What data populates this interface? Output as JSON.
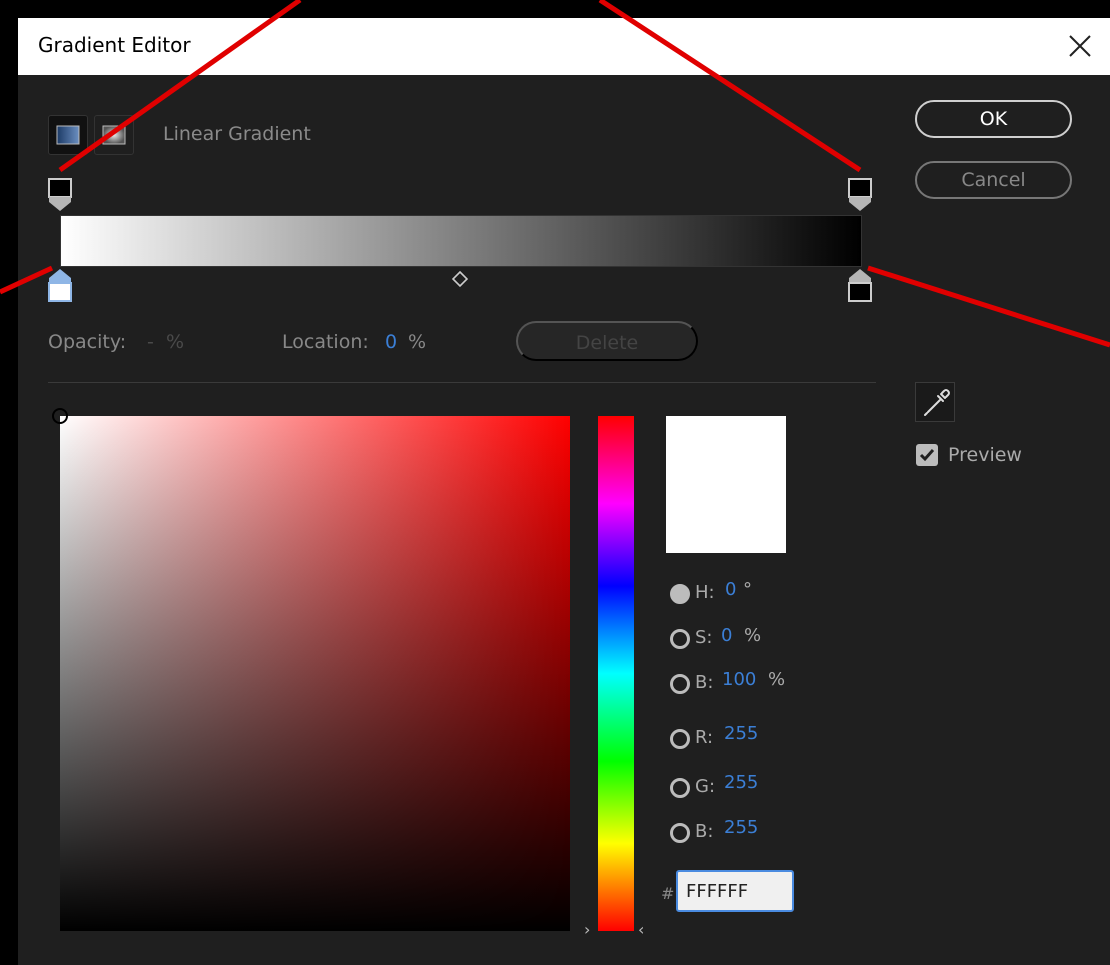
{
  "window": {
    "title": "Gradient Editor",
    "close_icon": "close-icon"
  },
  "gradient_type": {
    "label": "Linear Gradient",
    "options": [
      "linear-gradient-icon",
      "radial-gradient-icon"
    ]
  },
  "buttons": {
    "ok": "OK",
    "cancel": "Cancel",
    "delete": "Delete"
  },
  "stop_fields": {
    "opacity_label": "Opacity:",
    "opacity_value": "-",
    "opacity_unit": "%",
    "location_label": "Location:",
    "location_value": "0",
    "location_unit": "%"
  },
  "gradient": {
    "start_color": "#FFFFFF",
    "end_color": "#000000",
    "midpoint_percent": 50
  },
  "color": {
    "h_label": "H:",
    "h_value": "0",
    "h_unit": "°",
    "s_label": "S:",
    "s_value": "0",
    "s_unit": "%",
    "b_label": "B:",
    "b_value": "100",
    "b_unit": "%",
    "r_label": "R:",
    "r_value": "255",
    "g_label": "G:",
    "g_value": "255",
    "b2_label": "B:",
    "b2_value": "255",
    "hash_label": "#",
    "hex": "FFFFFF",
    "selected_mode": "H"
  },
  "preview": {
    "label": "Preview",
    "checked": true
  },
  "colors": {
    "dialog_bg": "#1F1F1F",
    "accent_blue": "#3B7FD6",
    "annotation_red": "#E00000"
  }
}
